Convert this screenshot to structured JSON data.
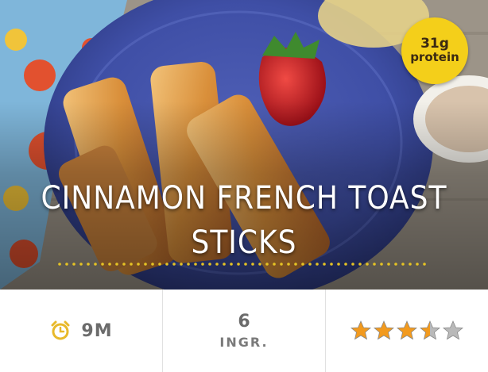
{
  "recipe": {
    "title": "Cinnamon French Toast Sticks",
    "badge": {
      "amount": "31g",
      "label": "protein"
    },
    "time": "9m",
    "ingredients": {
      "count": "6",
      "label": "INGR."
    },
    "rating": {
      "value": 3.5,
      "max": 5
    }
  },
  "colors": {
    "badge": "#f4cf1a",
    "stars_filled": "#f29a1e",
    "stars_empty": "#b9b9b9",
    "timer_icon": "#e8b92a",
    "dotted_underline": "#e5c324"
  },
  "icons": {
    "timer": "alarm-clock-icon",
    "star": "star-icon"
  }
}
